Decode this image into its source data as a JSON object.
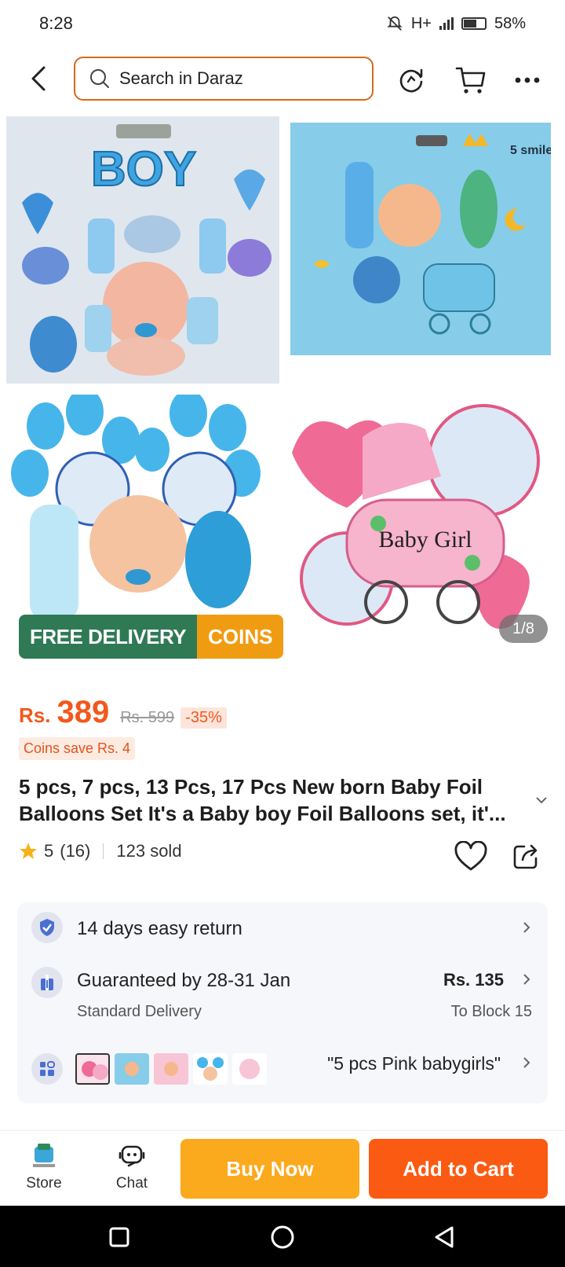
{
  "status_bar": {
    "time": "8:28",
    "network": "H+",
    "battery": "58%"
  },
  "header": {
    "search_placeholder": "Search in Daraz",
    "icons": [
      "back-arrow-icon",
      "search-icon",
      "refresh-icon",
      "cart-icon",
      "more-icon"
    ]
  },
  "gallery": {
    "counter": "1/8",
    "badge_free": "FREE DELIVERY",
    "badge_coins": "COINS",
    "image1_text": "BOY",
    "image2_text": "5 smile!",
    "image4_text": "Baby Girl"
  },
  "product": {
    "price_prefix": "Rs.",
    "price": "389",
    "old_price": "Rs. 599",
    "discount": "-35%",
    "coins_save": "Coins save Rs. 4",
    "title": "5 pcs, 7 pcs, 13 Pcs, 17 Pcs New born Baby Foil Balloons Set It's a Baby boy Foil Balloons set, it'...",
    "rating": "5",
    "rating_count": "(16)",
    "sold": "123 sold"
  },
  "info": {
    "return": "14 days easy return",
    "guarantee": "Guaranteed by 28-31 Jan",
    "delivery_type": "Standard Delivery",
    "delivery_price": "Rs. 135",
    "delivery_dest": "To Block 15",
    "variant": "\"5 pcs Pink babygirls\""
  },
  "bottom_bar": {
    "store": "Store",
    "chat": "Chat",
    "buy_now": "Buy Now",
    "add_to_cart": "Add to Cart"
  },
  "colors": {
    "accent": "#f2581c",
    "search_border": "#d8681c",
    "free_badge": "#2f7a55",
    "coins_badge": "#f09c13",
    "buy_now": "#fba91d",
    "add_to_cart": "#fb5a12"
  }
}
